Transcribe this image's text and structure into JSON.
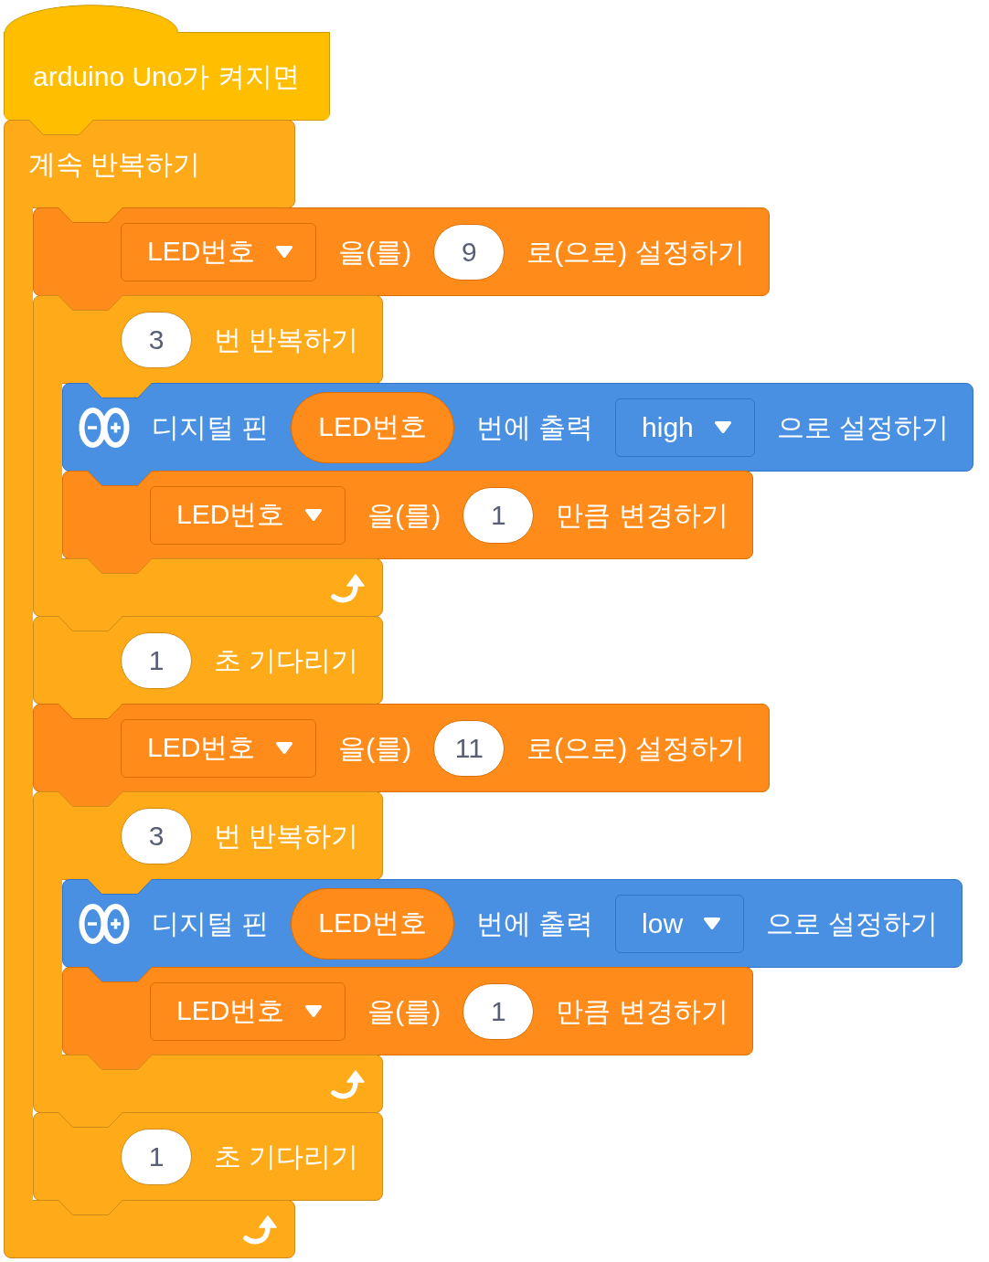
{
  "script": [
    {
      "kind": "hat",
      "parts": [
        {
          "kind": "text",
          "value": "arduino Uno가 켜지면"
        }
      ]
    },
    {
      "kind": "loop",
      "parts": [
        {
          "kind": "text",
          "value": "계속 반복하기"
        }
      ],
      "children": [
        {
          "kind": "variable",
          "parts": [
            {
              "kind": "dropdown",
              "value": "LED번호"
            },
            {
              "kind": "text",
              "value": "을(를)"
            },
            {
              "kind": "number",
              "value": "9"
            },
            {
              "kind": "text",
              "value": "로(으로) 설정하기"
            }
          ]
        },
        {
          "kind": "loop",
          "parts": [
            {
              "kind": "number",
              "value": "3"
            },
            {
              "kind": "text",
              "value": "번 반복하기"
            }
          ],
          "children": [
            {
              "kind": "arduino",
              "parts": [
                {
                  "kind": "text",
                  "value": "디지털 핀"
                },
                {
                  "kind": "reporter",
                  "value": "LED번호"
                },
                {
                  "kind": "text",
                  "value": "번에 출력"
                },
                {
                  "kind": "dropdown",
                  "value": "high"
                },
                {
                  "kind": "text",
                  "value": "으로 설정하기"
                }
              ]
            },
            {
              "kind": "variable",
              "parts": [
                {
                  "kind": "dropdown",
                  "value": "LED번호"
                },
                {
                  "kind": "text",
                  "value": "을(를)"
                },
                {
                  "kind": "number",
                  "value": "1"
                },
                {
                  "kind": "text",
                  "value": "만큼 변경하기"
                }
              ]
            }
          ]
        },
        {
          "kind": "control",
          "parts": [
            {
              "kind": "number",
              "value": "1"
            },
            {
              "kind": "text",
              "value": "초 기다리기"
            }
          ]
        },
        {
          "kind": "variable",
          "parts": [
            {
              "kind": "dropdown",
              "value": "LED번호"
            },
            {
              "kind": "text",
              "value": "을(를)"
            },
            {
              "kind": "number",
              "value": "11"
            },
            {
              "kind": "text",
              "value": "로(으로) 설정하기"
            }
          ]
        },
        {
          "kind": "loop",
          "parts": [
            {
              "kind": "number",
              "value": "3"
            },
            {
              "kind": "text",
              "value": "번 반복하기"
            }
          ],
          "children": [
            {
              "kind": "arduino",
              "parts": [
                {
                  "kind": "text",
                  "value": "디지털 핀"
                },
                {
                  "kind": "reporter",
                  "value": "LED번호"
                },
                {
                  "kind": "text",
                  "value": "번에 출력"
                },
                {
                  "kind": "dropdown",
                  "value": "low"
                },
                {
                  "kind": "text",
                  "value": "으로 설정하기"
                }
              ]
            },
            {
              "kind": "variable",
              "parts": [
                {
                  "kind": "dropdown",
                  "value": "LED번호"
                },
                {
                  "kind": "text",
                  "value": "을(를)"
                },
                {
                  "kind": "number",
                  "value": "1"
                },
                {
                  "kind": "text",
                  "value": "만큼 변경하기"
                }
              ]
            }
          ]
        },
        {
          "kind": "control",
          "parts": [
            {
              "kind": "number",
              "value": "1"
            },
            {
              "kind": "text",
              "value": "초 기다리기"
            }
          ]
        }
      ]
    }
  ]
}
